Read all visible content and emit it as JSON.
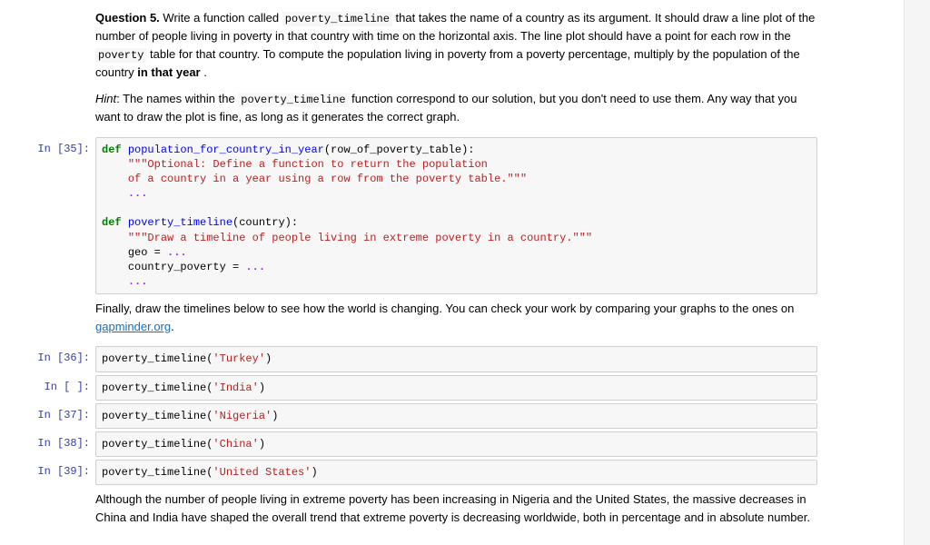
{
  "question": {
    "label": "Question 5.",
    "para1_pre": "Write a function called ",
    "func_name": "poverty_timeline",
    "para1_mid": " that takes the name of a country as its argument. It should draw a line plot of the number of people living in poverty in that country with time on the horizontal axis. The line plot should have a point for each row in the ",
    "table_name": "poverty",
    "para1_post": " table for that country. To compute the population living in poverty from a poverty percentage, multiply by the population of the country ",
    "bold_phrase": "in that year",
    "para1_end": ".",
    "hint_label": "Hint",
    "hint_pre": ": The names within the ",
    "hint_func": "poverty_timeline",
    "hint_post": " function correspond to our solution, but you don't need to use them. Any way that you want to draw the plot is fine, as long as it generates the correct graph."
  },
  "cell35": {
    "prompt": "In [35]:",
    "l1": {
      "def": "def",
      "fn": "population_for_country_in_year",
      "params": "(row_of_poverty_table):"
    },
    "l2": "    \"\"\"Optional: Define a function to return the population ",
    "l3": "    of a country in a year using a row from the poverty table.\"\"\"",
    "l4": "    ...",
    "l5": "",
    "l6": {
      "def": "def",
      "fn": "poverty_timeline",
      "params": "(country):"
    },
    "l7": "    \"\"\"Draw a timeline of people living in extreme poverty in a country.\"\"\"",
    "l8": {
      "a": "    geo ",
      "eq": "=",
      "b": " ..."
    },
    "l9": {
      "a": "    country_poverty ",
      "eq": "=",
      "b": " ..."
    },
    "l10": "    ..."
  },
  "finally": {
    "text_pre": "Finally, draw the timelines below to see how the world is changing. You can check your work by comparing your graphs to the ones on ",
    "link": "gapminder.org",
    "text_post": "."
  },
  "cells": [
    {
      "prompt": "In [36]:",
      "fn": "poverty_timeline",
      "arg": "'Turkey'"
    },
    {
      "prompt": "In [ ]:",
      "fn": "poverty_timeline",
      "arg": "'India'"
    },
    {
      "prompt": "In [37]:",
      "fn": "poverty_timeline",
      "arg": "'Nigeria'"
    },
    {
      "prompt": "In [38]:",
      "fn": "poverty_timeline",
      "arg": "'China'"
    },
    {
      "prompt": "In [39]:",
      "fn": "poverty_timeline",
      "arg": "'United States'"
    }
  ],
  "conclusion": "Although the number of people living in extreme poverty has been increasing in Nigeria and the United States, the massive decreases in China and India have shaped the overall trend that extreme poverty is decreasing worldwide, both in percentage and in absolute number."
}
